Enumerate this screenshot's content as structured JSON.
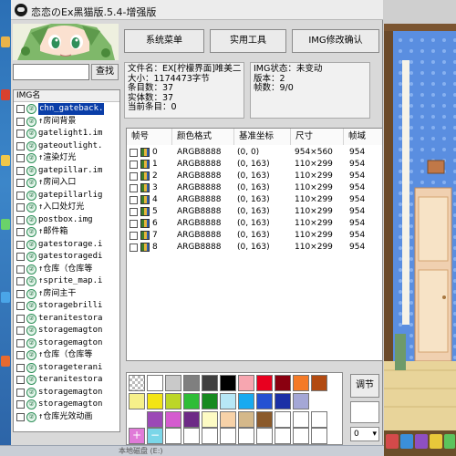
{
  "window": {
    "title": "恋恋のEx黑猫版.5.4-增强版"
  },
  "search": {
    "value": "",
    "button_label": "查找"
  },
  "toolbar": {
    "system_menu": "系统菜单",
    "tools": "实用工具",
    "img_confirm": "IMG修改确认"
  },
  "file_info": {
    "name": "文件名：EX[柠檬界面]唯美二",
    "size": "大小：1174473字节",
    "entries": "条目数：37",
    "real_entries": "实体数：37",
    "current": "当前条目：0"
  },
  "img_info": {
    "status": "IMG状态：未变动",
    "version": "版本：2",
    "frames": "帧数：9/0"
  },
  "img_list": {
    "header": "IMG名",
    "items": [
      {
        "name": "chn_gateback.",
        "selected": true
      },
      {
        "name": "↑房间背景"
      },
      {
        "name": "gatelight1.im"
      },
      {
        "name": "gateoutlight."
      },
      {
        "name": "↑渲染灯光"
      },
      {
        "name": "gatepillar.im"
      },
      {
        "name": "↑房间入口"
      },
      {
        "name": "gatepillarlig"
      },
      {
        "name": "↑入口处灯光"
      },
      {
        "name": "postbox.img"
      },
      {
        "name": "↑邮件箱"
      },
      {
        "name": "gatestorage.i"
      },
      {
        "name": "gatestoragedi"
      },
      {
        "name": "↑仓库（仓库等"
      },
      {
        "name": "↑sprite_map.i"
      },
      {
        "name": "↑房间主干"
      },
      {
        "name": "storagebrilli"
      },
      {
        "name": "teranitestora"
      },
      {
        "name": "storagemagton"
      },
      {
        "name": "storagemagton"
      },
      {
        "name": "↑仓库（仓库等"
      },
      {
        "name": "storageterani"
      },
      {
        "name": "teranitestora"
      },
      {
        "name": "storagemagton"
      },
      {
        "name": "storagemagton"
      },
      {
        "name": "↑仓库光效动画"
      }
    ]
  },
  "frames_table": {
    "columns": [
      "帧号",
      "颜色格式",
      "基准坐标",
      "尺寸",
      "帧域"
    ],
    "rows": [
      {
        "num": "0",
        "format": "ARGB8888",
        "coord": "(0, 0)",
        "size": "954×560",
        "domain": "954"
      },
      {
        "num": "1",
        "format": "ARGB8888",
        "coord": "(0, 163)",
        "size": "110×299",
        "domain": "954"
      },
      {
        "num": "2",
        "format": "ARGB8888",
        "coord": "(0, 163)",
        "size": "110×299",
        "domain": "954"
      },
      {
        "num": "3",
        "format": "ARGB8888",
        "coord": "(0, 163)",
        "size": "110×299",
        "domain": "954"
      },
      {
        "num": "4",
        "format": "ARGB8888",
        "coord": "(0, 163)",
        "size": "110×299",
        "domain": "954"
      },
      {
        "num": "5",
        "format": "ARGB8888",
        "coord": "(0, 163)",
        "size": "110×299",
        "domain": "954"
      },
      {
        "num": "6",
        "format": "ARGB8888",
        "coord": "(0, 163)",
        "size": "110×299",
        "domain": "954"
      },
      {
        "num": "7",
        "format": "ARGB8888",
        "coord": "(0, 163)",
        "size": "110×299",
        "domain": "954"
      },
      {
        "num": "8",
        "format": "ARGB8888",
        "coord": "(0, 163)",
        "size": "110×299",
        "domain": "954"
      }
    ]
  },
  "palette": {
    "row1": [
      "#ffffff",
      "#c9c9c9",
      "#7f7f7f",
      "#3f3f3f",
      "#000000",
      "#f7a6b0",
      "#e8001f",
      "#8a0010",
      "#f47a27",
      "#b24a11"
    ],
    "row2": [
      "#f6f08a",
      "#f3e414",
      "#bcd627",
      "#2fbd37",
      "#178a1f",
      "#b7e7f6",
      "#18aaf0",
      "#2451d2",
      "#1b2fa6",
      "#a4a7d6"
    ],
    "row3": [
      "#9b49b6",
      "#d45bcf",
      "#6d2a86",
      "#fdfbc4",
      "#f7d2a8",
      "#d4b88a",
      "#8b5a2b",
      "#ffffff",
      "#ffffff",
      "#ffffff"
    ],
    "add_label": "+",
    "remove_label": "−"
  },
  "side": {
    "adjust_button": "调节",
    "page_select": "0"
  },
  "taskbar": {
    "text": "本地磁盘 (E:)"
  }
}
